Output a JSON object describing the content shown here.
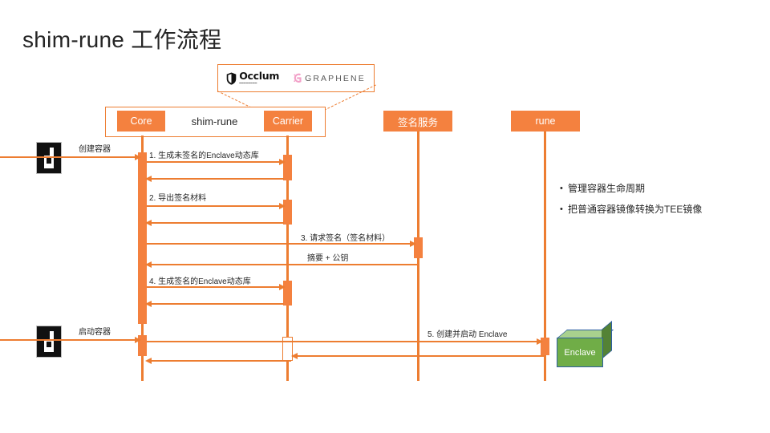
{
  "slide": {
    "title": "shim-rune 工作流程",
    "accent_color": "#ED7D31",
    "actor_fill": "#F4813F",
    "enclave_color": "#70AD47"
  },
  "logos": {
    "occlum": {
      "name": "Occlum",
      "icon": "shield-icon",
      "subtitle": ""
    },
    "graphene": {
      "name": "GRAPHENE",
      "icon": "graphene-g-icon"
    }
  },
  "actors": {
    "shim_rune": {
      "label": "shim-rune"
    },
    "core": {
      "label": "Core"
    },
    "carrier": {
      "label": "Carrier"
    },
    "sign_service": {
      "label": "签名服务"
    },
    "rune": {
      "label": "rune"
    }
  },
  "external": {
    "create_container": "创建容器",
    "start_container": "启动容器",
    "docker_icon": "docker-icon"
  },
  "messages": [
    {
      "id": 1,
      "label": "1. 生成未签名的Enclave动态库"
    },
    {
      "id": 2,
      "label": "2. 导出签名材料"
    },
    {
      "id": 3,
      "label": "3. 请求签名（签名材料）"
    },
    {
      "id": 4,
      "label": "摘要 + 公钥"
    },
    {
      "id": 5,
      "label": "4. 生成签名的Enclave动态库"
    },
    {
      "id": 6,
      "label": "5. 创建并启动 Enclave"
    }
  ],
  "enclave": {
    "label": "Enclave"
  },
  "notes": {
    "bullet_marker": "•",
    "items": [
      "管理容器生命周期",
      "把普通容器镜像转换为TEE镜像"
    ]
  }
}
